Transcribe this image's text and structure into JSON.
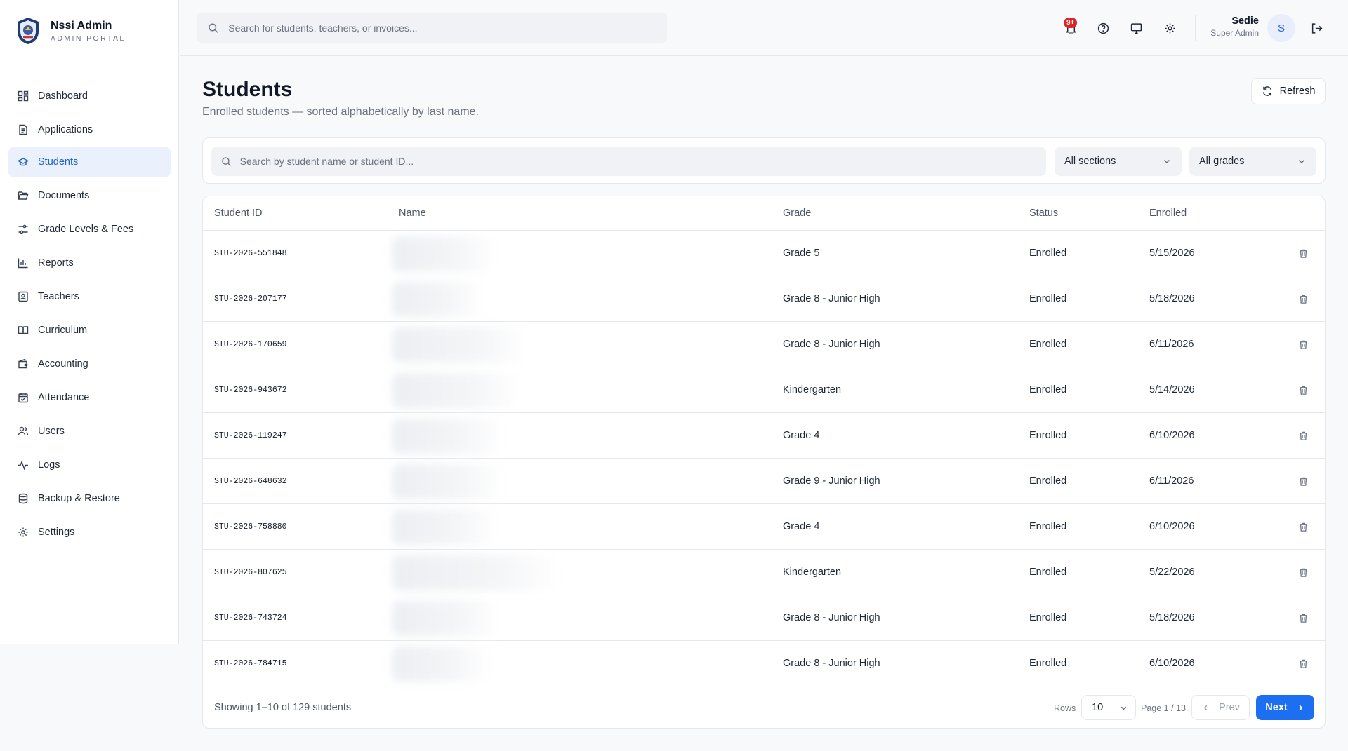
{
  "brand": {
    "name": "Nssi Admin",
    "subtitle": "ADMIN PORTAL"
  },
  "sidebar": {
    "items": [
      {
        "label": "Dashboard",
        "icon": "dashboard-icon"
      },
      {
        "label": "Applications",
        "icon": "file-text-icon"
      },
      {
        "label": "Students",
        "icon": "graduation-cap-icon",
        "active": true
      },
      {
        "label": "Documents",
        "icon": "folder-open-icon"
      },
      {
        "label": "Grade Levels & Fees",
        "icon": "sliders-icon"
      },
      {
        "label": "Reports",
        "icon": "bar-chart-icon"
      },
      {
        "label": "Teachers",
        "icon": "id-card-icon"
      },
      {
        "label": "Curriculum",
        "icon": "book-open-icon"
      },
      {
        "label": "Accounting",
        "icon": "wallet-icon"
      },
      {
        "label": "Attendance",
        "icon": "calendar-check-icon"
      },
      {
        "label": "Users",
        "icon": "users-icon"
      },
      {
        "label": "Logs",
        "icon": "activity-icon"
      },
      {
        "label": "Backup & Restore",
        "icon": "database-icon"
      },
      {
        "label": "Settings",
        "icon": "gear-icon"
      }
    ]
  },
  "header": {
    "search_placeholder": "Search for students, teachers, or invoices...",
    "notification_badge": "9+",
    "user_name": "Sedie",
    "user_role": "Super Admin",
    "avatar_initial": "S"
  },
  "page": {
    "title": "Students",
    "subtitle": "Enrolled students — sorted alphabetically by last name.",
    "refresh_label": "Refresh"
  },
  "filters": {
    "search_placeholder": "Search by student name or student ID...",
    "section_value": "All sections",
    "grade_value": "All grades"
  },
  "table": {
    "columns": [
      "Student ID",
      "Name",
      "Grade",
      "Status",
      "Enrolled"
    ],
    "rows": [
      {
        "id": "STU-2026-551848",
        "grade": "Grade 5",
        "status": "Enrolled",
        "enrolled": "5/15/2026"
      },
      {
        "id": "STU-2026-207177",
        "grade": "Grade 8 - Junior High",
        "status": "Enrolled",
        "enrolled": "5/18/2026"
      },
      {
        "id": "STU-2026-170659",
        "grade": "Grade 8 - Junior High",
        "status": "Enrolled",
        "enrolled": "6/11/2026"
      },
      {
        "id": "STU-2026-943672",
        "grade": "Kindergarten",
        "status": "Enrolled",
        "enrolled": "5/14/2026"
      },
      {
        "id": "STU-2026-119247",
        "grade": "Grade 4",
        "status": "Enrolled",
        "enrolled": "6/10/2026"
      },
      {
        "id": "STU-2026-648632",
        "grade": "Grade 9 - Junior High",
        "status": "Enrolled",
        "enrolled": "6/11/2026"
      },
      {
        "id": "STU-2026-758880",
        "grade": "Grade 4",
        "status": "Enrolled",
        "enrolled": "6/10/2026"
      },
      {
        "id": "STU-2026-807625",
        "grade": "Kindergarten",
        "status": "Enrolled",
        "enrolled": "5/22/2026"
      },
      {
        "id": "STU-2026-743724",
        "grade": "Grade 8 - Junior High",
        "status": "Enrolled",
        "enrolled": "5/18/2026"
      },
      {
        "id": "STU-2026-784715",
        "grade": "Grade 8 - Junior High",
        "status": "Enrolled",
        "enrolled": "6/10/2026"
      }
    ]
  },
  "footer": {
    "showing": "Showing 1–10 of 129 students",
    "rows_label": "Rows",
    "rows_value": "10",
    "page_info": "Page 1 / 13",
    "prev_label": "Prev",
    "next_label": "Next"
  },
  "colors": {
    "accent": "#1d6ff2",
    "active_bg": "#eaf1fd",
    "active_text": "#1e63c4",
    "badge": "#dc2626"
  }
}
